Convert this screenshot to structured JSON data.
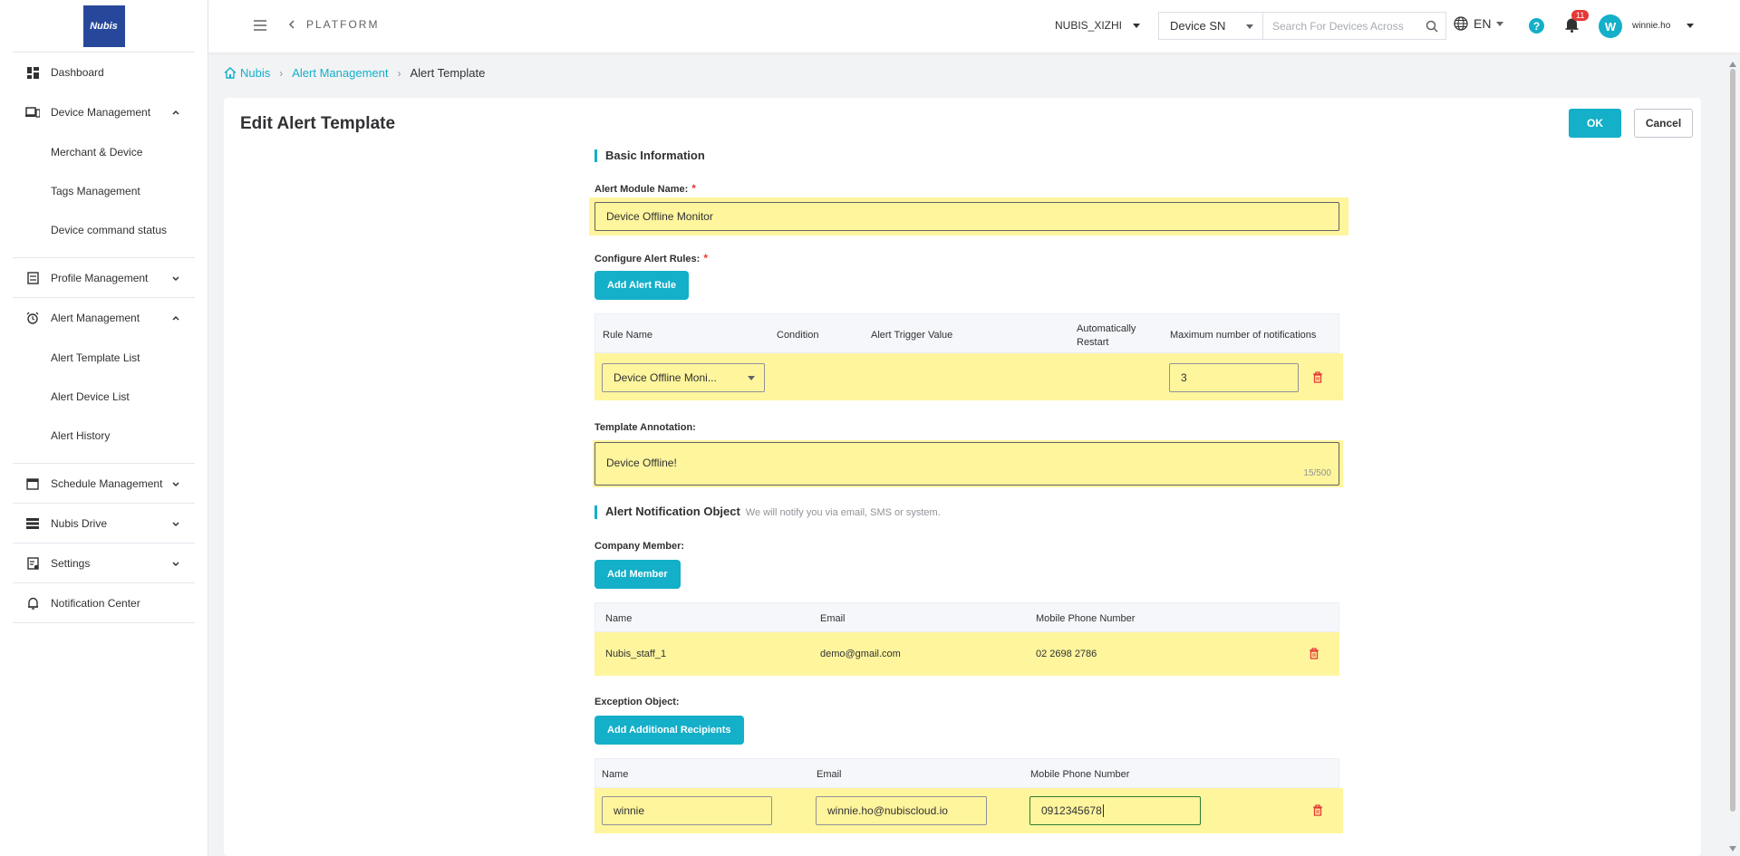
{
  "sidebar": {
    "logo_text": "Nubis",
    "items": [
      {
        "label": "Dashboard"
      },
      {
        "label": "Device Management"
      },
      {
        "label": "Merchant & Device"
      },
      {
        "label": "Tags Management"
      },
      {
        "label": "Device command status"
      },
      {
        "label": "Profile Management"
      },
      {
        "label": "Alert Management"
      },
      {
        "label": "Alert Template List"
      },
      {
        "label": "Alert Device List"
      },
      {
        "label": "Alert History"
      },
      {
        "label": "Schedule Management"
      },
      {
        "label": "Nubis Drive"
      },
      {
        "label": "Settings"
      },
      {
        "label": "Notification Center"
      }
    ]
  },
  "topbar": {
    "platform_label": "PLATFORM",
    "org": "NUBIS_XIZHI",
    "search_type": "Device SN",
    "search_placeholder": "Search For Devices Across",
    "language": "EN",
    "help": "?",
    "notification_count": "11",
    "avatar_initial": "W",
    "username": "winnie.ho"
  },
  "breadcrumb": {
    "home": "Nubis",
    "parent": "Alert Management",
    "current": "Alert Template"
  },
  "page": {
    "title": "Edit Alert Template",
    "ok_label": "OK",
    "cancel_label": "Cancel"
  },
  "form": {
    "basic_info_title": "Basic Information",
    "module_name_label": "Alert Module Name:",
    "module_name_value": "Device Offline Monitor",
    "rules_label": "Configure Alert Rules:",
    "add_rule_label": "Add Alert Rule",
    "rules_columns": [
      "Rule Name",
      "Condition",
      "Alert Trigger Value",
      "Automatically",
      "Restart",
      "Maximum number of notifications"
    ],
    "rule_row": {
      "rule_name": "Device Offline Moni...",
      "max_notifications": "3"
    },
    "annotation_label": "Template Annotation:",
    "annotation_value": "Device Offline!",
    "annotation_counter": "15/500",
    "notification_title": "Alert Notification Object",
    "notification_hint": "We will notify you via email, SMS or system.",
    "company_member_label": "Company Member:",
    "add_member_label": "Add Member",
    "member_columns": [
      "Name",
      "Email",
      "Mobile Phone Number"
    ],
    "member_row": {
      "name": "Nubis_staff_1",
      "email": "demo@gmail.com",
      "phone": "02 2698 2786"
    },
    "exception_label": "Exception Object:",
    "add_recipients_label": "Add Additional Recipients",
    "exception_columns": [
      "Name",
      "Email",
      "Mobile Phone Number"
    ],
    "exception_row": {
      "name": "winnie",
      "email": "winnie.ho@nubiscloud.io",
      "phone": "0912345678"
    }
  },
  "colors": {
    "accent": "#14afc8",
    "highlight": "#fff59d",
    "danger": "#e53935"
  }
}
